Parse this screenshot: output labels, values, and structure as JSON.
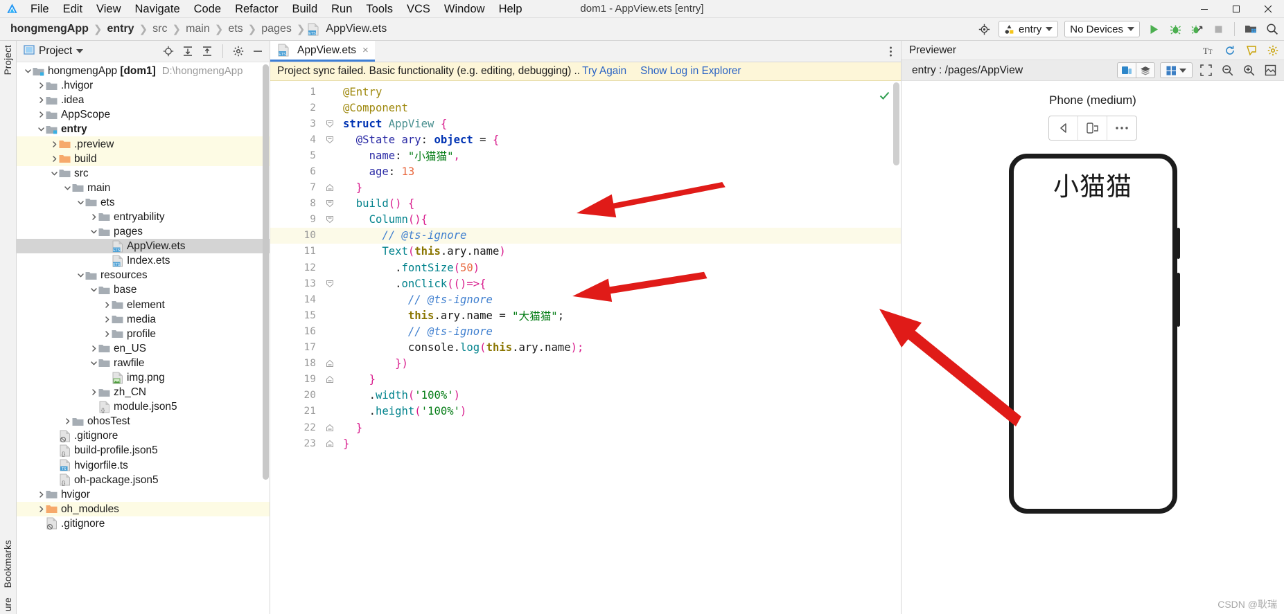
{
  "window": {
    "title": "dom1 - AppView.ets [entry]",
    "controls": [
      "minimize",
      "maximize",
      "close"
    ]
  },
  "menubar": {
    "logo": "deveco-logo-icon",
    "items": [
      "File",
      "Edit",
      "View",
      "Navigate",
      "Code",
      "Refactor",
      "Build",
      "Run",
      "Tools",
      "VCS",
      "Window",
      "Help"
    ]
  },
  "breadcrumb": {
    "items": [
      {
        "label": "hongmengApp",
        "bold": true
      },
      {
        "label": "entry",
        "bold": true
      },
      {
        "label": "src",
        "bold": false
      },
      {
        "label": "main",
        "bold": false
      },
      {
        "label": "ets",
        "bold": false
      },
      {
        "label": "pages",
        "bold": false
      },
      {
        "label": "AppView.ets",
        "bold": false,
        "icon": "ets-file-icon"
      }
    ]
  },
  "toolbar": {
    "target_icon": "target-icon",
    "run_config": "entry",
    "device": "No Devices",
    "actions": [
      "run-icon",
      "debug-icon",
      "profile-icon",
      "stop-icon",
      "device-manager-icon",
      "search-icon"
    ]
  },
  "rail": {
    "left_top": "Project",
    "left_bottom_1": "Bookmarks",
    "left_bottom_2": "ure"
  },
  "project_panel": {
    "title": "Project",
    "header_icons": [
      "locate-icon",
      "expand-all-icon",
      "collapse-all-icon",
      "settings-icon",
      "hide-icon"
    ],
    "tree": [
      {
        "label": "hongmengApp",
        "bold_suffix": "[dom1]",
        "path": "D:\\hongmengApp",
        "depth": 0,
        "icon": "module-folder-icon",
        "arrow": "down",
        "state": "normal"
      },
      {
        "label": ".hvigor",
        "depth": 1,
        "icon": "folder-icon",
        "arrow": "right",
        "state": "normal"
      },
      {
        "label": ".idea",
        "depth": 1,
        "icon": "folder-icon",
        "arrow": "right",
        "state": "normal"
      },
      {
        "label": "AppScope",
        "depth": 1,
        "icon": "folder-icon",
        "arrow": "right",
        "state": "normal"
      },
      {
        "label": "entry",
        "depth": 1,
        "icon": "module-folder-icon",
        "arrow": "down",
        "state": "normal",
        "bold": true
      },
      {
        "label": ".preview",
        "depth": 2,
        "icon": "folder-orange-icon",
        "arrow": "right",
        "state": "highlight"
      },
      {
        "label": "build",
        "depth": 2,
        "icon": "folder-orange-icon",
        "arrow": "right",
        "state": "highlight"
      },
      {
        "label": "src",
        "depth": 2,
        "icon": "folder-icon",
        "arrow": "down",
        "state": "normal"
      },
      {
        "label": "main",
        "depth": 3,
        "icon": "folder-icon",
        "arrow": "down",
        "state": "normal"
      },
      {
        "label": "ets",
        "depth": 4,
        "icon": "folder-icon",
        "arrow": "down",
        "state": "normal"
      },
      {
        "label": "entryability",
        "depth": 5,
        "icon": "folder-icon",
        "arrow": "right",
        "state": "normal"
      },
      {
        "label": "pages",
        "depth": 5,
        "icon": "folder-icon",
        "arrow": "down",
        "state": "normal"
      },
      {
        "label": "AppView.ets",
        "depth": 6,
        "icon": "ets-file-icon",
        "arrow": "none",
        "state": "selected"
      },
      {
        "label": "Index.ets",
        "depth": 6,
        "icon": "ets-file-icon",
        "arrow": "none",
        "state": "normal"
      },
      {
        "label": "resources",
        "depth": 4,
        "icon": "folder-icon",
        "arrow": "down",
        "state": "normal"
      },
      {
        "label": "base",
        "depth": 5,
        "icon": "folder-icon",
        "arrow": "down",
        "state": "normal"
      },
      {
        "label": "element",
        "depth": 6,
        "icon": "folder-icon",
        "arrow": "right",
        "state": "normal"
      },
      {
        "label": "media",
        "depth": 6,
        "icon": "folder-icon",
        "arrow": "right",
        "state": "normal"
      },
      {
        "label": "profile",
        "depth": 6,
        "icon": "folder-icon",
        "arrow": "right",
        "state": "normal"
      },
      {
        "label": "en_US",
        "depth": 5,
        "icon": "folder-icon",
        "arrow": "right",
        "state": "normal"
      },
      {
        "label": "rawfile",
        "depth": 5,
        "icon": "folder-icon",
        "arrow": "down",
        "state": "normal"
      },
      {
        "label": "img.png",
        "depth": 6,
        "icon": "image-file-icon",
        "arrow": "none",
        "state": "normal"
      },
      {
        "label": "zh_CN",
        "depth": 5,
        "icon": "folder-icon",
        "arrow": "right",
        "state": "normal"
      },
      {
        "label": "module.json5",
        "depth": 5,
        "icon": "json-file-icon",
        "arrow": "none",
        "state": "normal"
      },
      {
        "label": "ohosTest",
        "depth": 3,
        "icon": "folder-icon",
        "arrow": "right",
        "state": "normal"
      },
      {
        "label": ".gitignore",
        "depth": 2,
        "icon": "gitignore-file-icon",
        "arrow": "none",
        "state": "normal"
      },
      {
        "label": "build-profile.json5",
        "depth": 2,
        "icon": "json-file-icon",
        "arrow": "none",
        "state": "normal"
      },
      {
        "label": "hvigorfile.ts",
        "depth": 2,
        "icon": "ts-file-icon",
        "arrow": "none",
        "state": "normal"
      },
      {
        "label": "oh-package.json5",
        "depth": 2,
        "icon": "json-file-icon",
        "arrow": "none",
        "state": "normal"
      },
      {
        "label": "hvigor",
        "depth": 1,
        "icon": "folder-icon",
        "arrow": "right",
        "state": "normal"
      },
      {
        "label": "oh_modules",
        "depth": 1,
        "icon": "folder-orange-icon",
        "arrow": "right",
        "state": "highlight"
      },
      {
        "label": ".gitignore",
        "depth": 1,
        "icon": "gitignore-file-icon",
        "arrow": "none",
        "state": "normal"
      }
    ]
  },
  "editor": {
    "tab": {
      "label": "AppView.ets",
      "icon": "ets-file-icon",
      "close": "×"
    },
    "more_icon": "more-vertical-icon",
    "banner": {
      "text": "Project sync failed. Basic functionality (e.g. editing, debugging) ..",
      "link1": "Try Again",
      "link2": "Show Log in Explorer"
    },
    "status_icon": "check-ok-icon",
    "current_line": 10,
    "lines": [
      {
        "n": 1,
        "fold": "none",
        "indent": 0,
        "tokens": [
          {
            "t": "@Entry",
            "c": "k-dec"
          }
        ]
      },
      {
        "n": 2,
        "fold": "none",
        "indent": 0,
        "tokens": [
          {
            "t": "@Component",
            "c": "k-dec"
          }
        ]
      },
      {
        "n": 3,
        "fold": "open",
        "indent": 0,
        "tokens": [
          {
            "t": "struct ",
            "c": "k-kw"
          },
          {
            "t": "AppView ",
            "c": "k-type"
          },
          {
            "t": "{",
            "c": "k-brace"
          }
        ]
      },
      {
        "n": 4,
        "fold": "open",
        "indent": 1,
        "tokens": [
          {
            "t": "@State ",
            "c": "k-prop"
          },
          {
            "t": "ary",
            "c": "k-prop"
          },
          {
            "t": ": ",
            "c": "k-plain"
          },
          {
            "t": "object",
            "c": "k-kw"
          },
          {
            "t": " = ",
            "c": "k-plain"
          },
          {
            "t": "{",
            "c": "k-brace"
          }
        ]
      },
      {
        "n": 5,
        "fold": "none",
        "indent": 2,
        "tokens": [
          {
            "t": "name",
            "c": "k-prop"
          },
          {
            "t": ": ",
            "c": "k-plain"
          },
          {
            "t": "\"小猫猫\"",
            "c": "k-str"
          },
          {
            "t": ",",
            "c": "k-brace"
          }
        ]
      },
      {
        "n": 6,
        "fold": "none",
        "indent": 2,
        "tokens": [
          {
            "t": "age",
            "c": "k-prop"
          },
          {
            "t": ": ",
            "c": "k-plain"
          },
          {
            "t": "13",
            "c": "k-num"
          }
        ]
      },
      {
        "n": 7,
        "fold": "close",
        "indent": 1,
        "tokens": [
          {
            "t": "}",
            "c": "k-brace"
          }
        ]
      },
      {
        "n": 8,
        "fold": "open",
        "indent": 1,
        "tokens": [
          {
            "t": "build",
            "c": "k-fn"
          },
          {
            "t": "() ",
            "c": "k-brace"
          },
          {
            "t": "{",
            "c": "k-brace"
          }
        ]
      },
      {
        "n": 9,
        "fold": "open",
        "indent": 2,
        "tokens": [
          {
            "t": "Column",
            "c": "k-meth"
          },
          {
            "t": "(){",
            "c": "k-brace"
          }
        ]
      },
      {
        "n": 10,
        "fold": "none",
        "indent": 3,
        "tokens": [
          {
            "t": "// @ts-ignore",
            "c": "k-cmt"
          }
        ]
      },
      {
        "n": 11,
        "fold": "none",
        "indent": 3,
        "tokens": [
          {
            "t": "Text",
            "c": "k-meth"
          },
          {
            "t": "(",
            "c": "k-brace"
          },
          {
            "t": "this",
            "c": "k-this"
          },
          {
            "t": ".ary",
            "c": "k-plain"
          },
          {
            "t": ".name",
            "c": "k-plain"
          },
          {
            "t": ")",
            "c": "k-brace"
          }
        ]
      },
      {
        "n": 12,
        "fold": "none",
        "indent": 4,
        "tokens": [
          {
            "t": ".",
            "c": "k-plain"
          },
          {
            "t": "fontSize",
            "c": "k-meth"
          },
          {
            "t": "(",
            "c": "k-brace"
          },
          {
            "t": "50",
            "c": "k-num"
          },
          {
            "t": ")",
            "c": "k-brace"
          }
        ]
      },
      {
        "n": 13,
        "fold": "open",
        "indent": 4,
        "tokens": [
          {
            "t": ".",
            "c": "k-plain"
          },
          {
            "t": "onClick",
            "c": "k-meth"
          },
          {
            "t": "(()=>{",
            "c": "k-brace"
          }
        ]
      },
      {
        "n": 14,
        "fold": "none",
        "indent": 5,
        "tokens": [
          {
            "t": "// @ts-ignore",
            "c": "k-cmt"
          }
        ]
      },
      {
        "n": 15,
        "fold": "none",
        "indent": 5,
        "tokens": [
          {
            "t": "this",
            "c": "k-this"
          },
          {
            "t": ".ary.name = ",
            "c": "k-plain"
          },
          {
            "t": "\"大猫猫\"",
            "c": "k-str"
          },
          {
            "t": ";",
            "c": "k-plain"
          }
        ]
      },
      {
        "n": 16,
        "fold": "none",
        "indent": 5,
        "tokens": [
          {
            "t": "// @ts-ignore",
            "c": "k-cmt"
          }
        ]
      },
      {
        "n": 17,
        "fold": "none",
        "indent": 5,
        "tokens": [
          {
            "t": "console",
            "c": "k-plain"
          },
          {
            "t": ".",
            "c": "k-plain"
          },
          {
            "t": "log",
            "c": "k-meth"
          },
          {
            "t": "(",
            "c": "k-brace"
          },
          {
            "t": "this",
            "c": "k-this"
          },
          {
            "t": ".ary.name",
            "c": "k-plain"
          },
          {
            "t": ");",
            "c": "k-brace"
          }
        ]
      },
      {
        "n": 18,
        "fold": "close",
        "indent": 4,
        "tokens": [
          {
            "t": "})",
            "c": "k-brace"
          }
        ]
      },
      {
        "n": 19,
        "fold": "close",
        "indent": 2,
        "tokens": [
          {
            "t": "}",
            "c": "k-brace"
          }
        ]
      },
      {
        "n": 20,
        "fold": "none",
        "indent": 2,
        "tokens": [
          {
            "t": ".",
            "c": "k-plain"
          },
          {
            "t": "width",
            "c": "k-meth"
          },
          {
            "t": "(",
            "c": "k-brace"
          },
          {
            "t": "'100%'",
            "c": "k-str"
          },
          {
            "t": ")",
            "c": "k-brace"
          }
        ]
      },
      {
        "n": 21,
        "fold": "none",
        "indent": 2,
        "tokens": [
          {
            "t": ".",
            "c": "k-plain"
          },
          {
            "t": "height",
            "c": "k-meth"
          },
          {
            "t": "(",
            "c": "k-brace"
          },
          {
            "t": "'100%'",
            "c": "k-str"
          },
          {
            "t": ")",
            "c": "k-brace"
          }
        ]
      },
      {
        "n": 22,
        "fold": "close",
        "indent": 1,
        "tokens": [
          {
            "t": "}",
            "c": "k-brace"
          }
        ]
      },
      {
        "n": 23,
        "fold": "close",
        "indent": 0,
        "tokens": [
          {
            "t": "}",
            "c": "k-brace"
          }
        ]
      }
    ]
  },
  "previewer": {
    "title": "Previewer",
    "header_icons": [
      "font-size-icon",
      "refresh-icon",
      "inspector-icon",
      "settings-icon"
    ],
    "route": "entry : /pages/AppView",
    "sub_icons": [
      "multi-device-icon",
      "layers-icon",
      "grid-icon",
      "dropdown-icon",
      "fit-icon",
      "zoom-out-icon",
      "zoom-in-icon",
      "screenshot-icon"
    ],
    "device_name": "Phone (medium)",
    "device_controls": [
      "back-icon",
      "rotate-icon",
      "more-icon"
    ],
    "screen_text": "小猫猫",
    "watermark": "CSDN @耿瑞"
  },
  "annotations": {
    "arrow_color": "#e01b18",
    "arrows": 3
  }
}
